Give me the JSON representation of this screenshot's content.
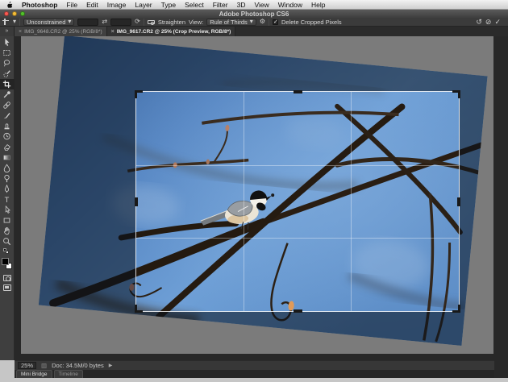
{
  "menu_bar": {
    "items": [
      "Photoshop",
      "File",
      "Edit",
      "Image",
      "Layer",
      "Type",
      "Select",
      "Filter",
      "3D",
      "View",
      "Window",
      "Help"
    ]
  },
  "title_bar": {
    "title": "Adobe Photoshop CS6"
  },
  "options_bar": {
    "preset": "Unconstrained",
    "width_value": "",
    "height_value": "",
    "straighten": "Straighten",
    "view_label": "View:",
    "overlay": "Rule of Thirds",
    "delete_cropped": "Delete Cropped Pixels",
    "delete_cropped_checked": true
  },
  "tabs": {
    "close": "×",
    "doc1": "IMG_9648.CR2 @ 25% (RGB/8*)",
    "doc2": "IMG_9617.CR2 @ 25% (Crop Preview, RGB/8*)"
  },
  "status_bar": {
    "zoom": "25%",
    "doc": "Doc: 34.5M/0 bytes"
  },
  "panels": {
    "mini_bridge": "Mini Bridge",
    "timeline": "Timeline"
  },
  "icons": {
    "swap": "⇄",
    "rotate": "⟳",
    "gear": "⚙",
    "reset": "↺",
    "cancel": "⊘",
    "commit": "✓",
    "check": "✓",
    "chevrons": "»",
    "arrow": "▶",
    "dropdown": "▾"
  },
  "colors": {
    "ui_dark": "#3b3b3b",
    "app_bg": "#282828",
    "pasteboard": "#7b7b7b",
    "sky_blue": "#6e9fd6",
    "dim_shield": "rgba(8,16,28,0.54)",
    "accent_text": "#d6d6d6"
  }
}
